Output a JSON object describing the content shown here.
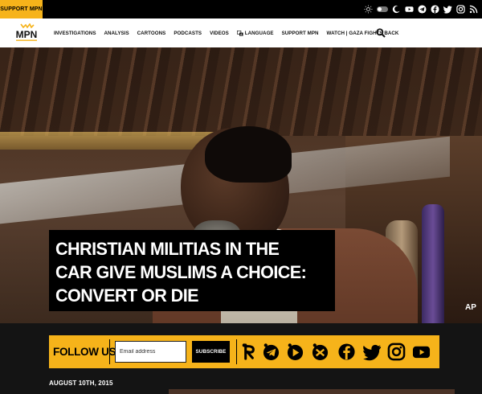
{
  "topbar": {
    "support_label": "SUPPORT MPN",
    "icons": [
      "sun-icon",
      "theme-toggle",
      "moon-icon",
      "youtube-icon",
      "telegram-icon",
      "facebook-icon",
      "twitter-icon",
      "instagram-icon",
      "rss-icon"
    ]
  },
  "navbar": {
    "logo_text": "MPN",
    "items": [
      {
        "label": "INVESTIGATIONS"
      },
      {
        "label": "ANALYSIS"
      },
      {
        "label": "CARTOONS"
      },
      {
        "label": "PODCASTS"
      },
      {
        "label": "VIDEOS"
      },
      {
        "label": "LANGUAGE"
      },
      {
        "label": "SUPPORT MPN"
      },
      {
        "label": "WATCH | GAZA FIGHTS BACK"
      }
    ]
  },
  "hero": {
    "headline": "CHRISTIAN MILITIAS IN THE CAR GIVE MUSLIMS A CHOICE: CONVERT OR DIE",
    "photo_credit": "AP"
  },
  "follow": {
    "label": "FOLLOW US",
    "email_placeholder": "Email address",
    "subscribe_label": "SUBSCRIBE",
    "social_icons": [
      "rumble-icon",
      "telegram-icon",
      "odysee-icon",
      "minds-icon",
      "facebook-icon",
      "twitter-icon",
      "instagram-icon",
      "youtube-icon"
    ]
  },
  "article": {
    "date": "AUGUST 10TH, 2015"
  },
  "colors": {
    "accent": "#f6b31a",
    "topbar_bg": "#000000",
    "page_bg": "#141414"
  }
}
